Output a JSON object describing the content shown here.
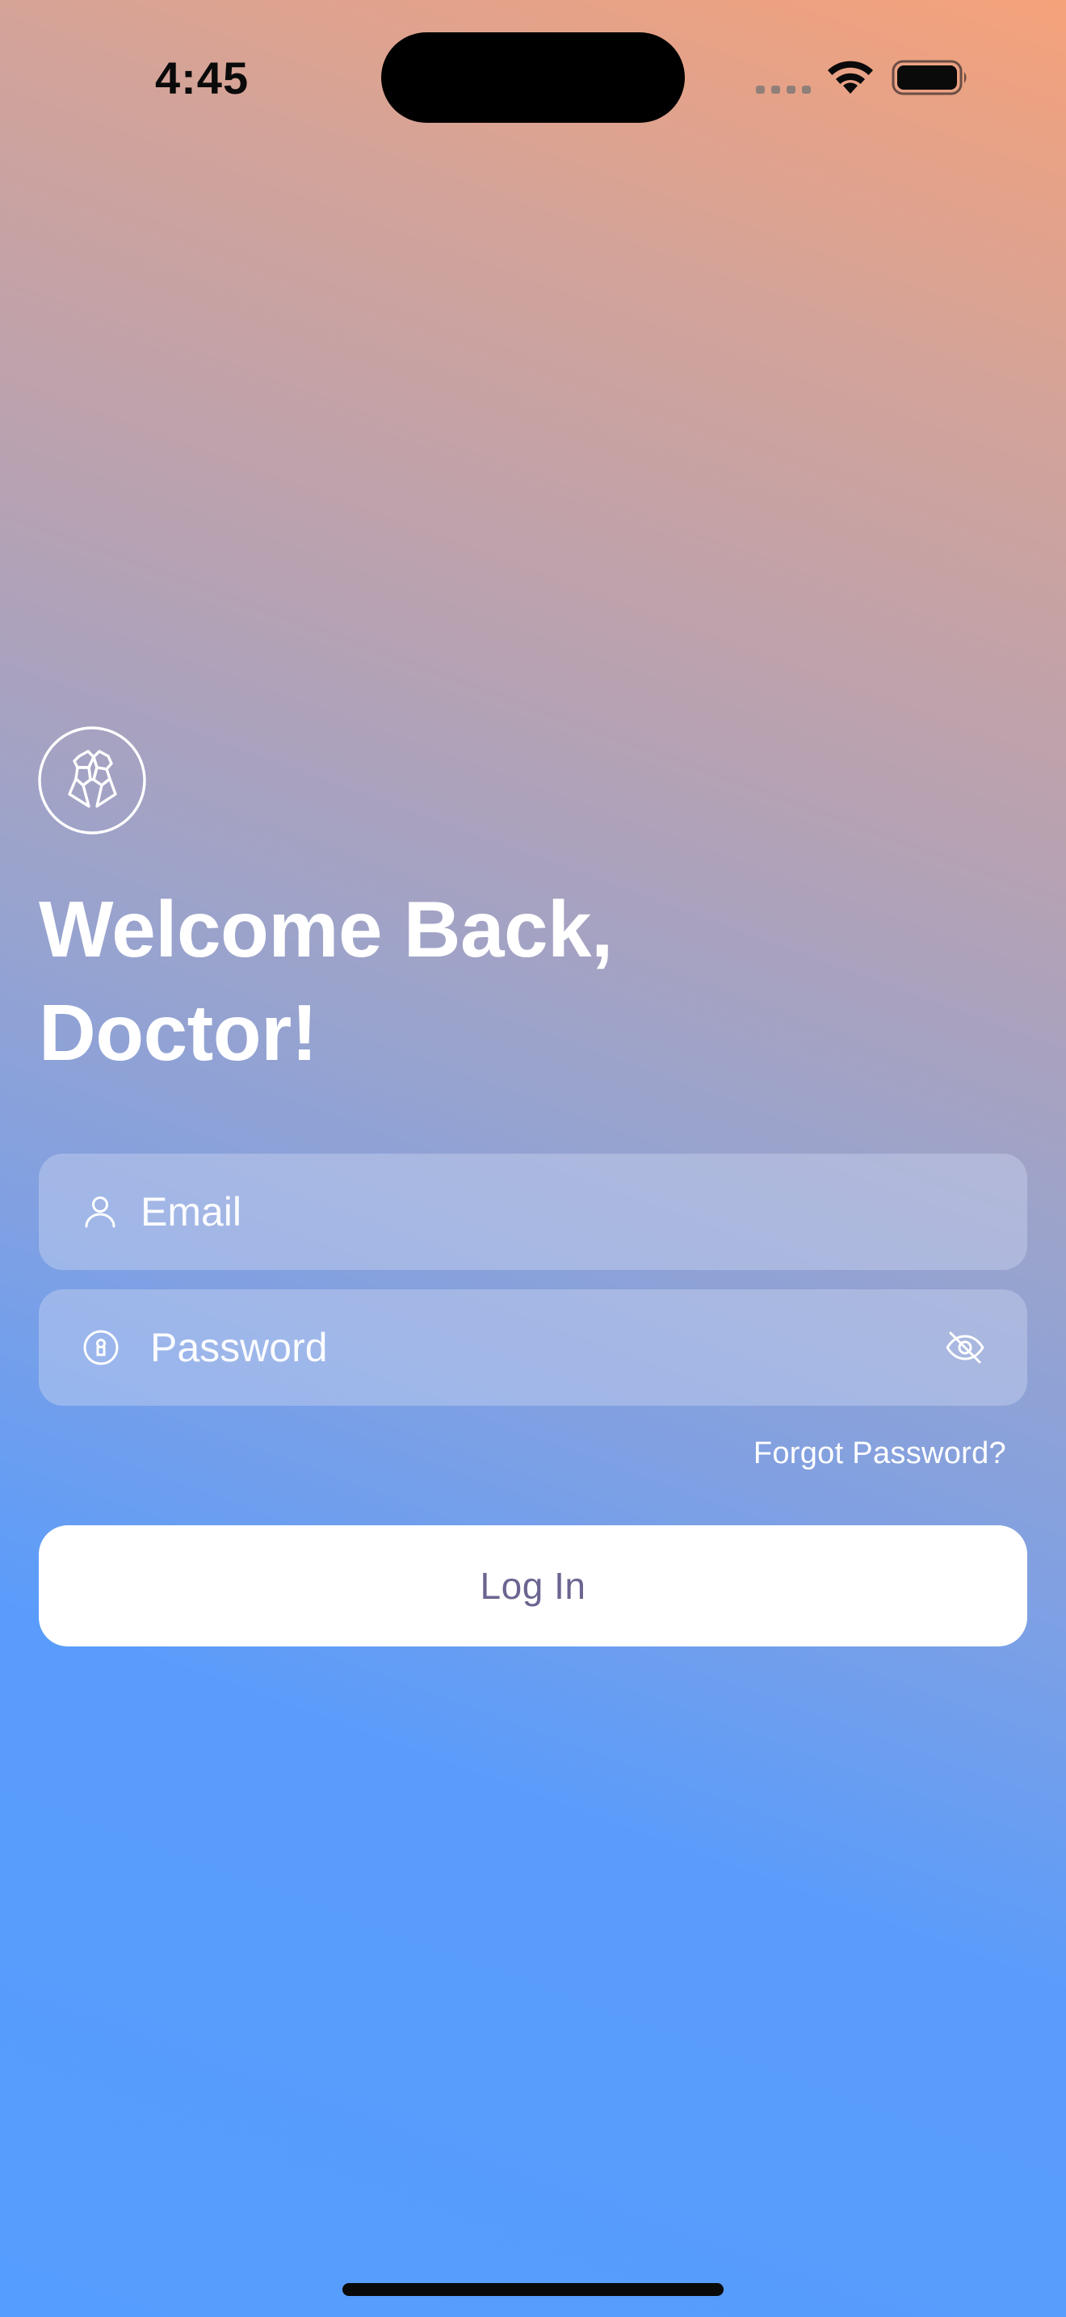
{
  "status_bar": {
    "time": "4:45",
    "icons": [
      "signal-icon",
      "wifi-icon",
      "battery-icon"
    ]
  },
  "app": {
    "logo_icon": "tooth-logo-icon"
  },
  "login": {
    "title": "Welcome Back,\nDoctor!",
    "email": {
      "placeholder": "Email",
      "value": "",
      "icon": "person-icon"
    },
    "password": {
      "placeholder": "Password",
      "value": "",
      "icon": "lock-icon",
      "toggle_icon": "eye-off-icon"
    },
    "forgot_password": "Forgot Password?",
    "submit_label": "Log In"
  },
  "colors": {
    "gradient_top": "#F5A27A",
    "gradient_mid": "#97A3CF",
    "gradient_bottom": "#559DFE",
    "button_text": "#6A6590"
  }
}
